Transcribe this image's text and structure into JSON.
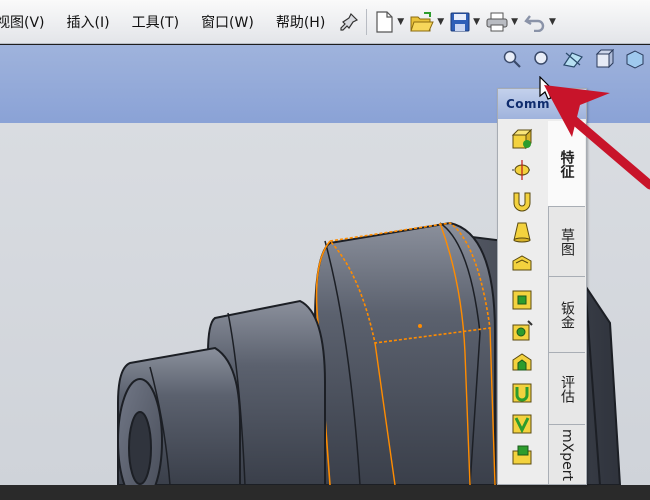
{
  "menu": [
    {
      "id": "view",
      "label": "视图(V)"
    },
    {
      "id": "insert",
      "label": "插入(I)"
    },
    {
      "id": "tools",
      "label": "工具(T)"
    },
    {
      "id": "window",
      "label": "窗口(W)"
    },
    {
      "id": "help",
      "label": "帮助(H)"
    }
  ],
  "command_manager": {
    "header": "Comm",
    "tabs": [
      {
        "id": "features",
        "label": "特征",
        "active": true
      },
      {
        "id": "sketch",
        "label": "草图",
        "active": false
      },
      {
        "id": "sheetmetal",
        "label": "钣金",
        "active": false
      },
      {
        "id": "evaluate",
        "label": "评估",
        "active": false
      },
      {
        "id": "dimxpert",
        "label": "mXpert",
        "active": false
      }
    ]
  },
  "colors": {
    "headsup": "#8aa2d6",
    "model": "#4a4f5a",
    "selection": "#ff8c00",
    "arrow": "#c8142a"
  }
}
